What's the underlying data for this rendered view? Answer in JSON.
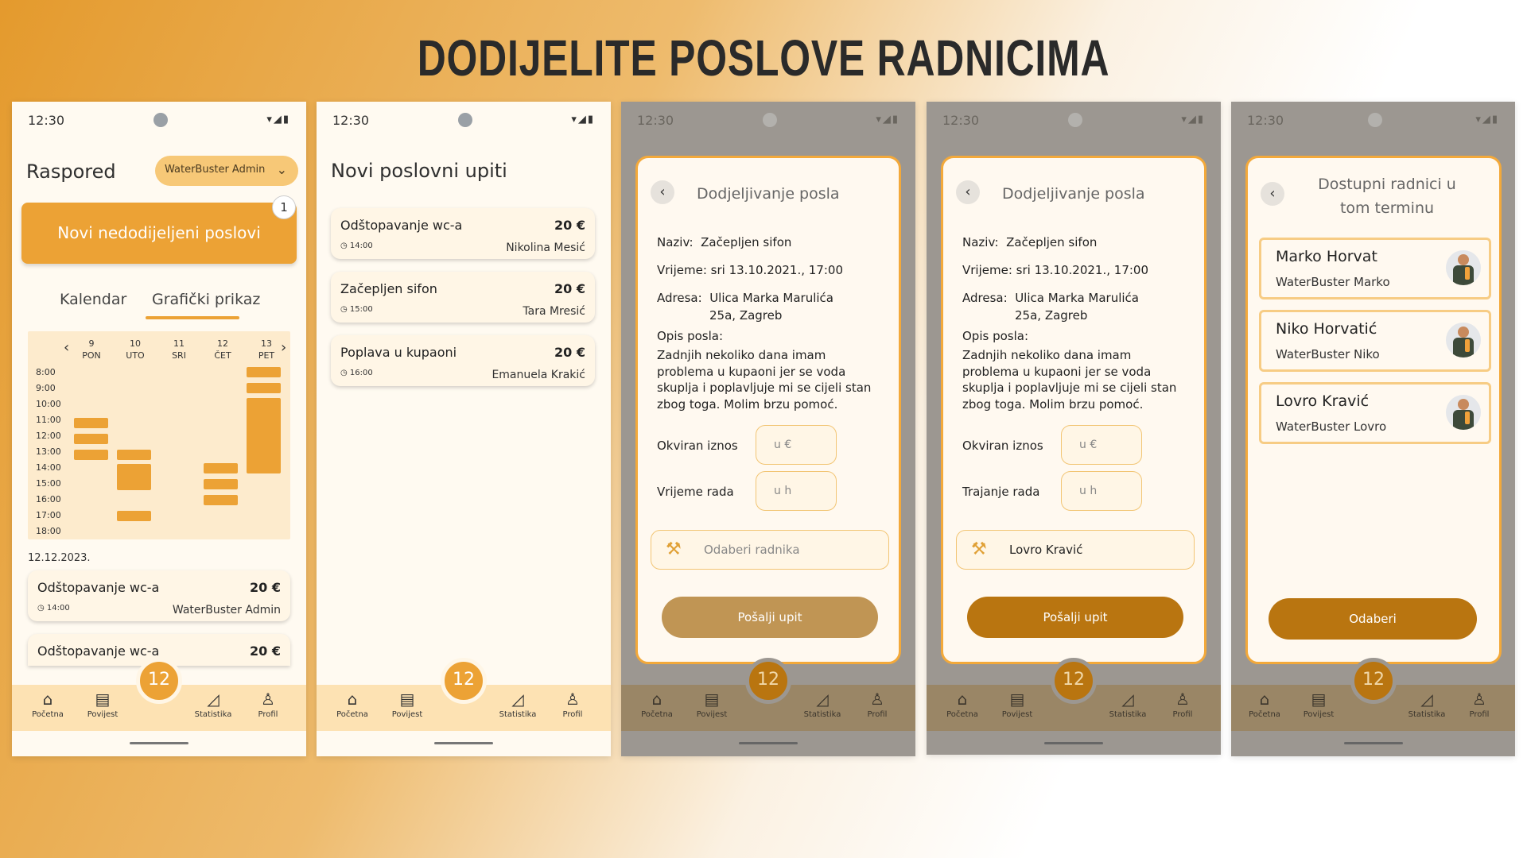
{
  "headline": "DODIJELITE POSLOVE RADNICIMA",
  "status_time": "12:30",
  "nav": {
    "home": "Početna",
    "history": "Povijest",
    "stats": "Statistika",
    "profile": "Profil",
    "fab": "12"
  },
  "screen1": {
    "title": "Raspored",
    "admin_chip": "WaterBuster Admin",
    "big_button": "Novi nedodijeljeni poslovi",
    "badge": "1",
    "tab_calendar": "Kalendar",
    "tab_graphic": "Grafički prikaz",
    "days": [
      {
        "num": "9",
        "name": "PON"
      },
      {
        "num": "10",
        "name": "UTO"
      },
      {
        "num": "11",
        "name": "SRI"
      },
      {
        "num": "12",
        "name": "ČET"
      },
      {
        "num": "13",
        "name": "PET"
      }
    ],
    "hours": [
      "8:00",
      "9:00",
      "10:00",
      "11:00",
      "12:00",
      "13:00",
      "14:00",
      "15:00",
      "16:00",
      "17:00",
      "18:00"
    ],
    "date": "12.12.2023.",
    "cards": [
      {
        "name": "Odštopavanje wc-a",
        "price": "20 €",
        "time": "14:00",
        "who": "WaterBuster Admin"
      },
      {
        "name": "Odštopavanje wc-a",
        "price": "20 €"
      }
    ]
  },
  "screen2": {
    "title": "Novi poslovni upiti",
    "cards": [
      {
        "name": "Odštopavanje wc-a",
        "price": "20 €",
        "time": "14:00",
        "who": "Nikolina Mesić"
      },
      {
        "name": "Začepljen sifon",
        "price": "20 €",
        "time": "15:00",
        "who": "Tara Mresić"
      },
      {
        "name": "Poplava u kupaoni",
        "price": "20 €",
        "time": "16:00",
        "who": "Emanuela Krakić"
      }
    ]
  },
  "assign": {
    "title": "Dodjeljivanje posla",
    "naziv_label": "Naziv:",
    "naziv": "Začepljen sifon",
    "vrijeme_label": "Vrijeme:",
    "vrijeme": "sri 13.10.2021., 17:00",
    "adresa_label": "Adresa:",
    "adresa1": "Ulica Marka Marulića",
    "adresa2": "25a, Zagreb",
    "opis_label": "Opis posla:",
    "opis": [
      "Zadnjih nekoliko dana imam",
      "problema u kupaoni jer se voda",
      "skuplja i poplavljuje mi se cijeli stan",
      "zbog toga. Molim brzu pomoć."
    ],
    "okviran_label": "Okviran iznos",
    "okviran_placeholder": "u €",
    "vrijeme_rada_label": "Vrijeme rada",
    "trajanje_rada_label": "Trajanje rada",
    "hours_placeholder": "u h",
    "pick_placeholder": "Odaberi radnika",
    "picked_worker": "Lovro Kravić",
    "send": "Pošalji upit"
  },
  "workers_screen": {
    "title_line1": "Dostupni radnici u",
    "title_line2": "tom terminu",
    "workers": [
      {
        "name": "Marko Horvat",
        "company": "WaterBuster Marko"
      },
      {
        "name": "Niko Horvatić",
        "company": "WaterBuster Niko"
      },
      {
        "name": "Lovro Kravić",
        "company": "WaterBuster Lovro"
      }
    ],
    "choose": "Odaberi"
  },
  "colors": {
    "accent": "#eca235",
    "accent_dark": "#b97510",
    "cream": "#fff9f0"
  }
}
